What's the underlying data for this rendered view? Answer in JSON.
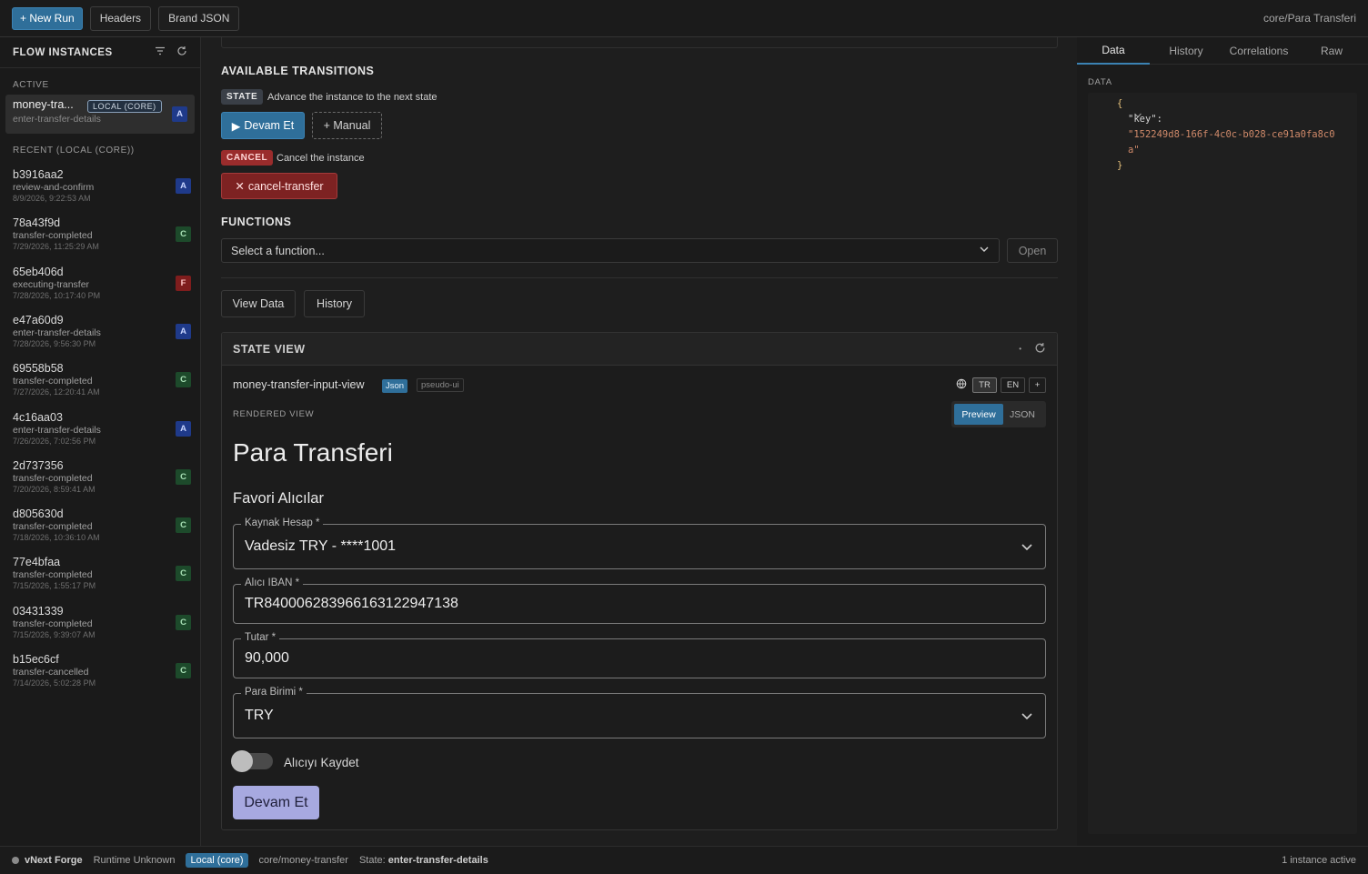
{
  "topbar": {
    "new_run": "+ New Run",
    "headers": "Headers",
    "brand_json": "Brand JSON",
    "breadcrumb": "core/Para Transferi"
  },
  "sidebar": {
    "title": "FLOW INSTANCES",
    "active_label": "ACTIVE",
    "active": {
      "name": "money-tra...",
      "tag": "LOCAL (CORE)",
      "state": "enter-transfer-details",
      "badge": "A"
    },
    "recent_label": "RECENT (LOCAL (CORE))",
    "runs": [
      {
        "id": "b3916aa2",
        "state": "review-and-confirm",
        "date": "8/9/2026, 9:22:53 AM",
        "badge": "A"
      },
      {
        "id": "78a43f9d",
        "state": "transfer-completed",
        "date": "7/29/2026, 11:25:29 AM",
        "badge": "C"
      },
      {
        "id": "65eb406d",
        "state": "executing-transfer",
        "date": "7/28/2026, 10:17:40 PM",
        "badge": "F"
      },
      {
        "id": "e47a60d9",
        "state": "enter-transfer-details",
        "date": "7/28/2026, 9:56:30 PM",
        "badge": "A"
      },
      {
        "id": "69558b58",
        "state": "transfer-completed",
        "date": "7/27/2026, 12:20:41 AM",
        "badge": "C"
      },
      {
        "id": "4c16aa03",
        "state": "enter-transfer-details",
        "date": "7/26/2026, 7:02:56 PM",
        "badge": "A"
      },
      {
        "id": "2d737356",
        "state": "transfer-completed",
        "date": "7/20/2026, 8:59:41 AM",
        "badge": "C"
      },
      {
        "id": "d805630d",
        "state": "transfer-completed",
        "date": "7/18/2026, 10:36:10 AM",
        "badge": "C"
      },
      {
        "id": "77e4bfaa",
        "state": "transfer-completed",
        "date": "7/15/2026, 1:55:17 PM",
        "badge": "C"
      },
      {
        "id": "03431339",
        "state": "transfer-completed",
        "date": "7/15/2026, 9:39:07 AM",
        "badge": "C"
      },
      {
        "id": "b15ec6cf",
        "state": "transfer-cancelled",
        "date": "7/14/2026, 5:02:28 PM",
        "badge": "C"
      }
    ]
  },
  "main": {
    "transitions_title": "AVAILABLE TRANSITIONS",
    "state_pill": "STATE",
    "state_desc": "Advance the instance to the next state",
    "devam_button": "Devam Et",
    "manual_button": "+ Manual",
    "cancel_pill": "CANCEL",
    "cancel_desc": "Cancel the instance",
    "cancel_button": "cancel-transfer",
    "functions_title": "FUNCTIONS",
    "function_placeholder": "Select a function...",
    "open_button": "Open",
    "view_data_button": "View Data",
    "history_button": "History",
    "state_view": {
      "title": "STATE VIEW",
      "view_name": "money-transfer-input-view",
      "tag_json": "Json",
      "tag_pseudo": "pseudo-ui",
      "langs": [
        "TR",
        "EN",
        "+"
      ],
      "rendered_label": "RENDERED VIEW",
      "preview_label": "Preview",
      "json_label": "JSON",
      "page_title": "Para Transferi",
      "subtitle": "Favori Alıcılar",
      "fields": [
        {
          "label": "Kaynak Hesap *",
          "value": "Vadesiz TRY - ****1001"
        },
        {
          "label": "Alıcı IBAN *",
          "value": "TR840006283966163122947138"
        },
        {
          "label": "Tutar *",
          "value": "90,000"
        },
        {
          "label": "Para Birimi *",
          "value": "TRY"
        }
      ],
      "switch_label": "Alıcıyı Kaydet",
      "submit_button": "Devam Et"
    }
  },
  "right_panel": {
    "tabs": [
      "Data",
      "History",
      "Correlations",
      "Raw"
    ],
    "data_label": "DATA",
    "json_key": "\"key\":",
    "json_value_line1": "\"152249d8-166f-4c0c-b028-ce91a0fa8c0",
    "json_value_line2": "a\""
  },
  "statusbar": {
    "brand": "vNext Forge",
    "runtime": "Runtime Unknown",
    "local": "Local (core)",
    "flow": "core/money-transfer",
    "state_prefix": "State:",
    "state_value": "enter-transfer-details",
    "instances": "1 instance active"
  },
  "colors": {
    "accent": "#2f6f9a",
    "badge_active": "#1f3a8a",
    "badge_completed": "#1d4a2b",
    "badge_failed": "#7f1d1d",
    "cancel": "#9a2c2c",
    "submit": "#a7a9e0"
  }
}
